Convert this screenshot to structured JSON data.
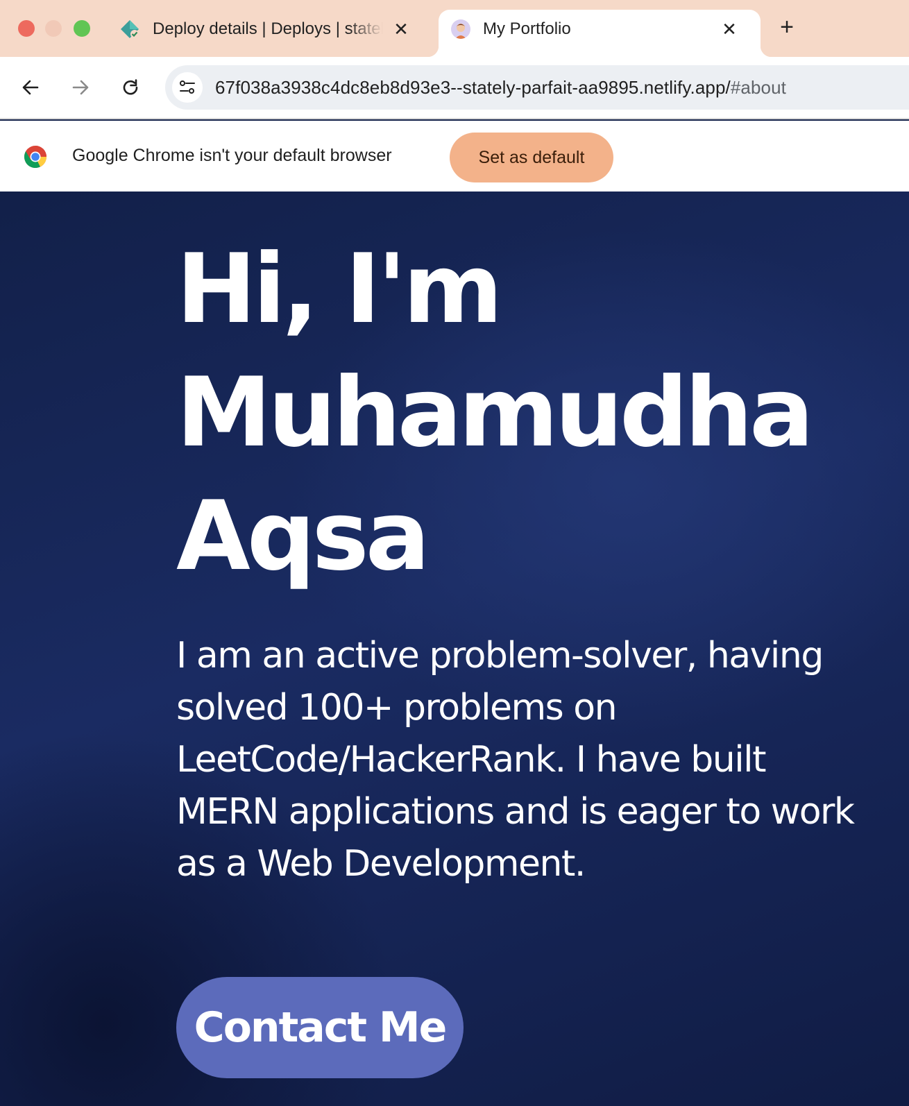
{
  "browser": {
    "tabs": [
      {
        "title": "Deploy details | Deploys | stately-parfait",
        "icon": "netlify-icon",
        "active": false
      },
      {
        "title": "My Portfolio",
        "icon": "avatar-favicon",
        "active": true
      }
    ],
    "new_tab_label": "+",
    "close_label": "✕",
    "address": {
      "url": "67f038a3938c4dc8eb8d93e3--stately-parfait-aa9895.netlify.app/",
      "hash": "#about"
    },
    "infobar": {
      "message": "Google Chrome isn't your default browser",
      "button_label": "Set as default"
    }
  },
  "hero": {
    "heading_lines": [
      "Hi, I'm",
      "Muhamudha",
      "Aqsa"
    ],
    "description": "I am an active problem-solver, having solved 100+ problems on LeetCode/HackerRank. I have built MERN applications and is eager to work as a Web Development.",
    "cta_label": "Contact Me"
  },
  "colors": {
    "tabstrip_bg": "#f6d9c8",
    "page_bg": "#14224a",
    "cta_bg": "#5c6bbb",
    "infobar_button_bg": "#f3b28a"
  }
}
